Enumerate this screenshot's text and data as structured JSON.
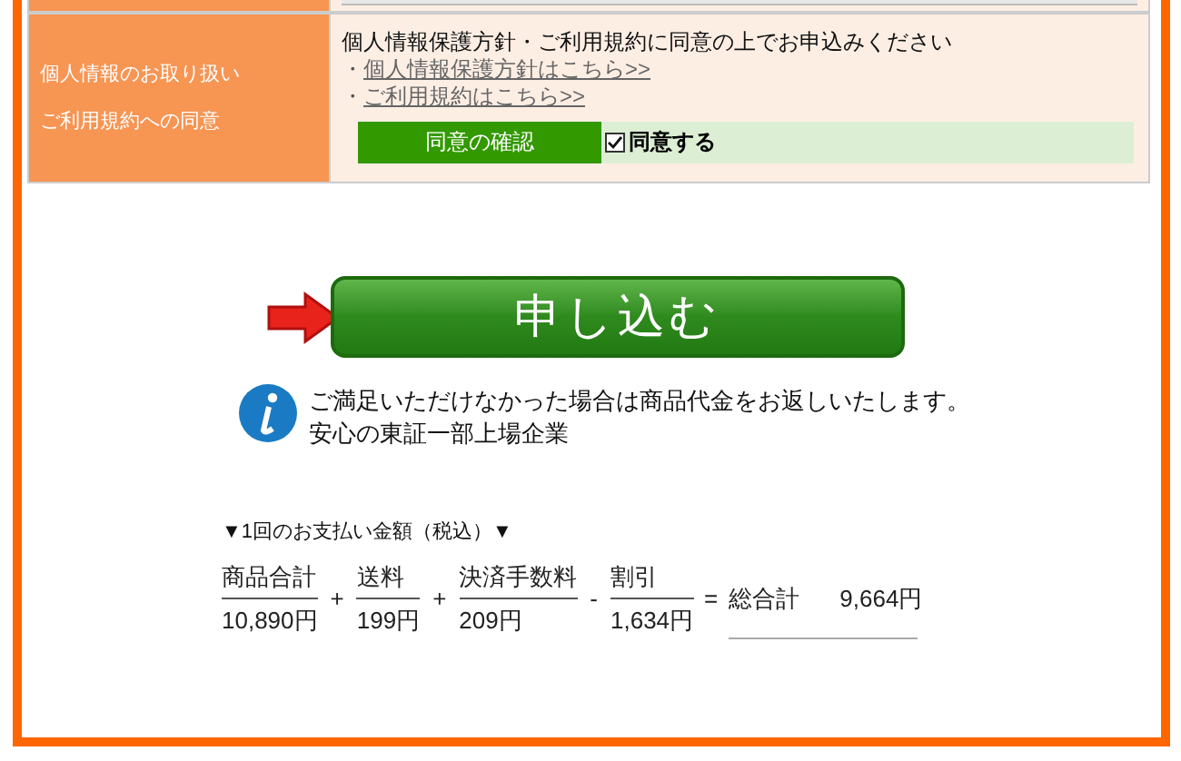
{
  "agreement": {
    "label_lines": [
      "個人情報のお取り扱い",
      "ご利用規約への同意"
    ],
    "instruction": "個人情報保護方針・ご利用規約に同意の上でお申込みください",
    "links": [
      {
        "bullet": "・",
        "text": "個人情報保護方針はこちら>>"
      },
      {
        "bullet": "・",
        "text": "ご利用規約はこちら>>"
      }
    ],
    "confirm_label": "同意の確認",
    "checkbox": {
      "label": "同意する",
      "checked": true
    }
  },
  "submit_button": "申し込む",
  "notice": {
    "lines": [
      "ご満足いただけなかった場合は商品代金をお返しいたします。",
      "安心の東証一部上場企業"
    ]
  },
  "payment": {
    "heading": "▼1回のお支払い金額（税込）▼",
    "terms": [
      {
        "label": "商品合計",
        "value": "10,890円"
      },
      {
        "op": "+",
        "label": "送料",
        "value": "199円"
      },
      {
        "op": "+",
        "label": "決済手数料",
        "value": "209円"
      },
      {
        "op": "-",
        "label": "割引",
        "value": "1,634円"
      }
    ],
    "equals": "=",
    "total_label": "総合計",
    "total_value": "9,664円"
  }
}
